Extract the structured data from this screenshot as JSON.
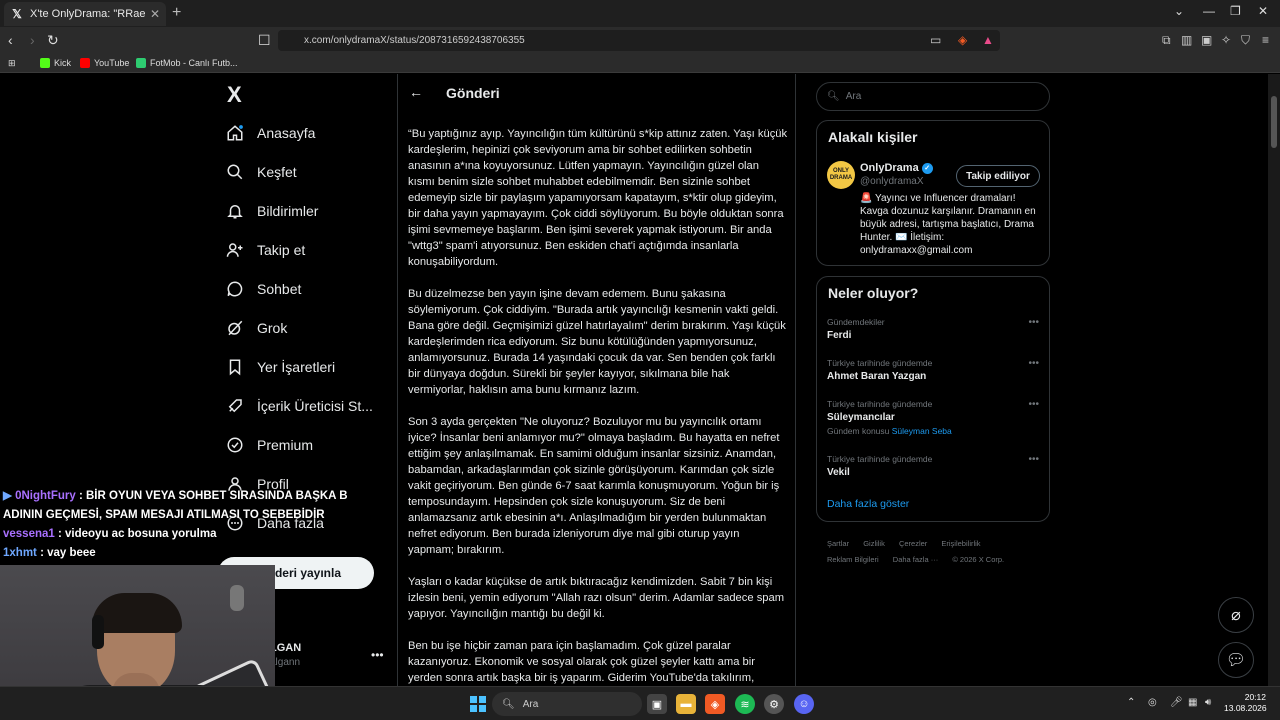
{
  "browser": {
    "tab_title": "X'te OnlyDrama: \"RRaenee canlı",
    "tab_close": "✕",
    "new_tab": "+",
    "url": "x.com/onlydramaX/status/2087316592438706355",
    "bookmarks": [
      {
        "label": "Kick",
        "color": "#53fc18"
      },
      {
        "label": "YouTube",
        "color": "#ff0000"
      },
      {
        "label": "FotMob - Canlı Futb...",
        "color": "#2ecc71"
      }
    ]
  },
  "leftnav": {
    "logo": "X",
    "items": [
      {
        "label": "Anasayfa",
        "icon": "home-icon"
      },
      {
        "label": "Keşfet",
        "icon": "search-icon"
      },
      {
        "label": "Bildirimler",
        "icon": "bell-icon"
      },
      {
        "label": "Takip et",
        "icon": "add-person-icon"
      },
      {
        "label": "Sohbet",
        "icon": "chat-icon"
      },
      {
        "label": "Grok",
        "icon": "grok-icon"
      },
      {
        "label": "Yer İşaretleri",
        "icon": "bookmark-icon"
      },
      {
        "label": "İçerik Üreticisi St...",
        "icon": "rocket-icon"
      },
      {
        "label": "Premium",
        "icon": "premium-icon"
      },
      {
        "label": "Profil",
        "icon": "profile-icon"
      },
      {
        "label": "Daha fazla",
        "icon": "more-icon"
      }
    ],
    "post_button": "Gönderi yayınla",
    "profile_name": "LGAN",
    "profile_handle": "algann",
    "profile_menu": "•••"
  },
  "main": {
    "header_title": "Gönderi",
    "paragraphs": [
      "“Bu yaptığınız ayıp. Yayıncılığın tüm kültürünü s*kip attınız zaten. Yaşı küçük kardeşlerim, hepinizi çok seviyorum ama bir sohbet edilirken sohbetin anasının a*ına koyuyorsunuz. Lütfen yapmayın. Yayıncılığın güzel olan kısmı benim sizle sohbet muhabbet edebilmemdir. Ben sizinle sohbet edemeyip sizle bir paylaşım yapamıyorsam kapatayım, s*ktir olup gideyim, bir daha yayın yapmayayım. Çok ciddi söylüyorum. Bu böyle olduktan sonra işimi sevmemeye başlarım. Ben işimi severek yapmak istiyorum. Bir anda \"wttg3\" spam'i atıyorsunuz. Ben eskiden chat'i açtığımda insanlarla konuşabiliyordum.",
      "Bu düzelmezse ben yayın işine devam edemem. Bunu şakasına söylemiyorum. Çok ciddiyim. \"Burada artık yayıncılığı kesmenin vakti geldi. Bana göre değil. Geçmişimizi güzel hatırlayalım\" derim bırakırım. Yaşı küçük kardeşlerimden rica ediyorum. Siz bunu kötülüğünden yapmıyorsunuz, anlamıyorsunuz. Burada 14 yaşındaki çocuk da var. Sen benden çok farklı bir dünyaya doğdun. Sürekli bir şeyler kayıyor, sıkılmana bile hak vermiyorlar, haklısın ama bunu kırmanız lazım.",
      "Son 3 ayda gerçekten \"Ne oluyoruz? Bozuluyor mu bu yayıncılık ortamı iyice? İnsanlar beni anlamıyor mu?\" olmaya başladım. Bu hayatta en nefret ettiğim şey anlaşılmamak. En samimi olduğum insanlar sizsiniz. Anamdan, babamdan, arkadaşlarımdan çok sizinle görüşüyorum. Karımdan çok sizle vakit geçiriyorum. Ben günde 6-7 saat karımla konuşmuyorum. Yoğun bir iş temposundayım. Hepsinden çok sizle konuşuyorum. Siz de beni anlamazsanız artık ebesinin a*ı. Anlaşılmadığım bir yerden bulunmaktan nefret ediyorum. Ben burada izleniyorum diye mal gibi oturup yayın yapmam; bırakırım.",
      "Yaşları o kadar küçükse de artık bıktıracağız kendimizden. Sabit 7 bin kişi izlesin beni, yemin ediyorum \"Allah razı olsun\" derim. Adamlar sadece spam yapıyor. Yayıncılığın mantığı bu değil ki.",
      "Ben bu işe hiçbir zaman para için başlamadım. Çok güzel paralar kazanıyoruz. Ekonomik ve sosyal olarak çok güzel şeyler kattı ama bir yerden sonra artık başka bir iş yaparım. Giderim YouTube'da takılırım,"
    ]
  },
  "right": {
    "search_placeholder": "Ara",
    "related_title": "Alakalı kişiler",
    "related": {
      "avatar_text": "ONLY DRAMA",
      "name": "OnlyDrama",
      "handle": "@onlydramaX",
      "follow_label": "Takip ediliyor",
      "bio": "🚨 Yayıncı ve Influencer dramaları! Kavga dozunuz karşılanır. Dramanın en büyük adresi, tartışma başlatıcı, Drama Hunter. ✉️ İletişim: onlydramaxx@gmail.com"
    },
    "trends_title": "Neler oluyor?",
    "trends": [
      {
        "category": "Gündemdekiler",
        "name": "Ferdi",
        "sub": "",
        "sub_link": ""
      },
      {
        "category": "Türkiye tarihinde gündemde",
        "name": "Ahmet Baran Yazgan",
        "sub": "",
        "sub_link": ""
      },
      {
        "category": "Türkiye tarihinde gündemde",
        "name": "Süleymancılar",
        "sub": "Gündem konusu",
        "sub_link": "Süleyman Seba"
      },
      {
        "category": "Türkiye tarihinde gündemde",
        "name": "Vekil",
        "sub": "",
        "sub_link": ""
      }
    ],
    "trend_menu": "•••",
    "show_more": "Daha fazla göster",
    "footer": [
      "Şartlar",
      "Gizlilik",
      "Çerezler",
      "Erişilebilirlik",
      "Reklam Bilgileri",
      "Daha fazla ···",
      "© 2026 X Corp."
    ]
  },
  "stream_chat": [
    {
      "user": "0NightFury",
      "message": ": BİR OYUN VEYA SOHBET SIRASINDA BAŞKA B ADININ GEÇMESİ, SPAM MESAJI ATILMASI TO SEBEBİDİR",
      "color": "#a970ff"
    },
    {
      "user": "vessena1",
      "message": ": videoyu ac bosuna yorulma",
      "color": "#a970ff"
    },
    {
      "user": "1xhmt",
      "message": ": vay beee",
      "color": "#6fa8ff"
    }
  ],
  "taskbar": {
    "search_label": "Ara",
    "time": "20:12",
    "date": "13.08.2026"
  }
}
